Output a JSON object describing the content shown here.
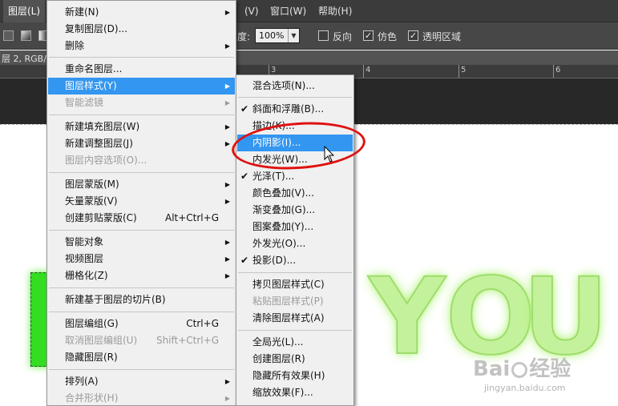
{
  "menubar": {
    "active_item": "图层(L)",
    "items": [
      "图层(L)",
      "(V)",
      "窗口(W)",
      "帮助(H)"
    ]
  },
  "options_bar": {
    "opacity_label": "度:",
    "opacity_value": "100%",
    "reverse_label": "反向",
    "dither_label": "仿色",
    "transparency_label": "透明区域",
    "reverse_checked": false,
    "dither_checked": true,
    "transparency_checked": true
  },
  "document": {
    "tab_label": "层 2, RGB/",
    "ruler_ticks": [
      "3",
      "4",
      "5",
      "6"
    ]
  },
  "canvas_text": {
    "letter_y": "Y",
    "letter_o": "O",
    "letter_u": "U"
  },
  "watermark": {
    "brand_left": "Bai",
    "brand_right": "经验",
    "url": "jingyan.baidu.com"
  },
  "layer_menu": {
    "items": [
      {
        "label": "新建(N)",
        "submenu": true
      },
      {
        "label": "复制图层(D)..."
      },
      {
        "label": "删除",
        "submenu": true
      },
      {
        "label": "重命名图层..."
      },
      {
        "label": "图层样式(Y)",
        "submenu": true,
        "highlight": true
      },
      {
        "label": "智能滤镜",
        "submenu": true,
        "disabled": true
      },
      {
        "label": "新建填充图层(W)",
        "submenu": true
      },
      {
        "label": "新建调整图层(J)",
        "submenu": true
      },
      {
        "label": "图层内容选项(O)...",
        "disabled": true
      },
      {
        "label": "图层蒙版(M)",
        "submenu": true
      },
      {
        "label": "矢量蒙版(V)",
        "submenu": true
      },
      {
        "label": "创建剪贴蒙版(C)",
        "shortcut": "Alt+Ctrl+G"
      },
      {
        "label": "智能对象",
        "submenu": true
      },
      {
        "label": "视频图层",
        "submenu": true
      },
      {
        "label": "栅格化(Z)",
        "submenu": true
      },
      {
        "label": "新建基于图层的切片(B)"
      },
      {
        "label": "图层编组(G)",
        "shortcut": "Ctrl+G"
      },
      {
        "label": "取消图层编组(U)",
        "shortcut": "Shift+Ctrl+G",
        "disabled": true
      },
      {
        "label": "隐藏图层(R)"
      },
      {
        "label": "排列(A)",
        "submenu": true
      },
      {
        "label": "合并形状(H)",
        "submenu": true,
        "disabled": true
      }
    ]
  },
  "style_menu": {
    "items": [
      {
        "label": "混合选项(N)..."
      },
      {
        "label": "斜面和浮雕(B)...",
        "checked": true
      },
      {
        "label": "描边(K)..."
      },
      {
        "label": "内阴影(I)...",
        "highlight": true
      },
      {
        "label": "内发光(W)..."
      },
      {
        "label": "光泽(T)...",
        "checked": true
      },
      {
        "label": "颜色叠加(V)..."
      },
      {
        "label": "渐变叠加(G)..."
      },
      {
        "label": "图案叠加(Y)..."
      },
      {
        "label": "外发光(O)..."
      },
      {
        "label": "投影(D)...",
        "checked": true
      },
      {
        "label": "拷贝图层样式(C)"
      },
      {
        "label": "粘贴图层样式(P)",
        "disabled": true
      },
      {
        "label": "清除图层样式(A)"
      },
      {
        "label": "全局光(L)..."
      },
      {
        "label": "创建图层(R)"
      },
      {
        "label": "隐藏所有效果(H)"
      },
      {
        "label": "缩放效果(F)..."
      }
    ]
  },
  "colors": {
    "menu_highlight": "#3396f0",
    "annotation": "#e01010",
    "text_glow": "#a6f06a"
  },
  "icons": {
    "submenu": "triangle-right",
    "check": "check-mark",
    "cursor": "arrow-pointer"
  }
}
